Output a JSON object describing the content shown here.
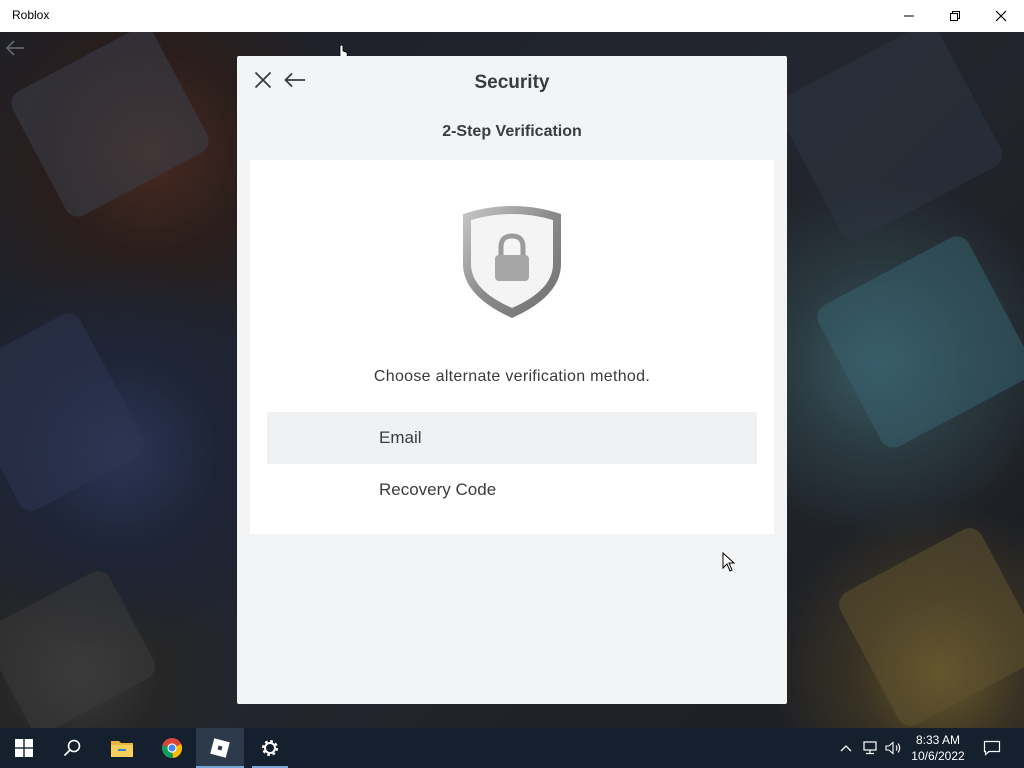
{
  "window": {
    "title": "Roblox",
    "controls": {
      "minimize_icon": "minimize-icon",
      "restore_icon": "restore-icon",
      "close_icon": "close-icon"
    }
  },
  "modal": {
    "title": "Security",
    "subtitle": "2-Step Verification",
    "close_icon": "close-icon",
    "back_icon": "back-arrow-icon",
    "illustration_icon": "shield-lock-icon",
    "prompt": "Choose alternate verification method.",
    "options": [
      {
        "label": "Email",
        "highlighted": true
      },
      {
        "label": "Recovery Code",
        "highlighted": false
      }
    ]
  },
  "taskbar": {
    "items": [
      {
        "icon": "windows-start-icon"
      },
      {
        "icon": "search-icon"
      },
      {
        "icon": "file-explorer-icon"
      },
      {
        "icon": "chrome-icon"
      },
      {
        "icon": "roblox-icon",
        "active": true
      },
      {
        "icon": "settings-gear-icon",
        "running": true
      }
    ],
    "tray": [
      "chevron-up-icon",
      "network-icon",
      "volume-icon"
    ],
    "clock": {
      "time": "8:33 AM",
      "date": "10/6/2022"
    },
    "notification_icon": "action-center-icon"
  },
  "colors": {
    "modal_bg": "#f2f4f5",
    "card_bg": "#ffffff",
    "text": "#393b3d",
    "taskbar": "#15202e",
    "highlight_row": "#f0f1f2"
  }
}
